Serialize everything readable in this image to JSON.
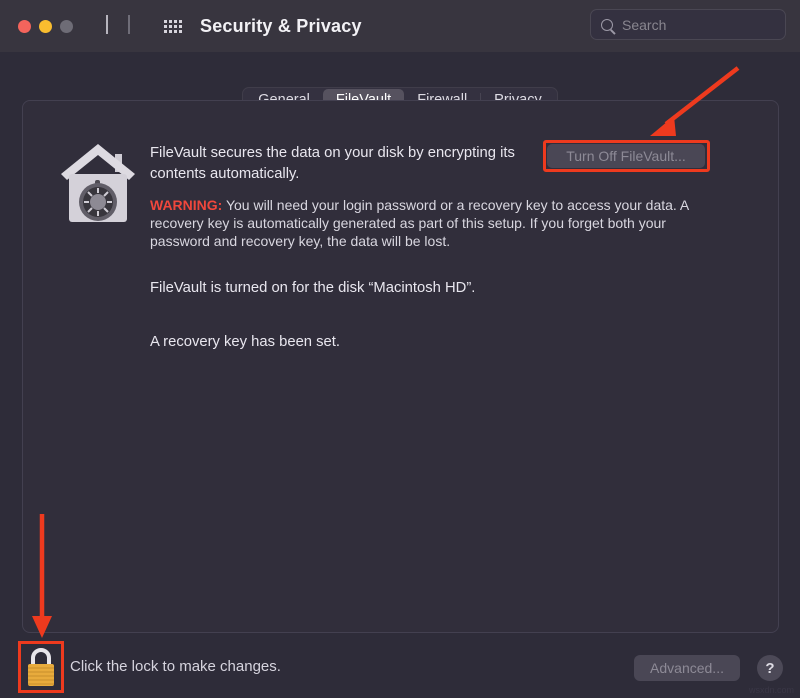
{
  "window": {
    "title": "Security & Privacy",
    "traffic_lights": [
      "close",
      "minimize",
      "maximize"
    ],
    "nav": {
      "back": "back-chevron",
      "forward": "forward-chevron"
    },
    "grid_icon": "show-all-preferences-grid-icon"
  },
  "search": {
    "placeholder": "Search",
    "value": "",
    "icon": "search-icon"
  },
  "tabs": [
    {
      "label": "General",
      "active": false
    },
    {
      "label": "FileVault",
      "active": true
    },
    {
      "label": "Firewall",
      "active": false
    },
    {
      "label": "Privacy",
      "active": false
    }
  ],
  "filevault": {
    "icon": "filevault-house-safe-icon",
    "description": "FileVault secures the data on your disk by encrypting its contents automatically.",
    "warning_label": "WARNING:",
    "warning_body": " You will need your login password or a recovery key to access your data. A recovery key is automatically generated as part of this setup. If you forget both your password and recovery key, the data will be lost.",
    "status_disk": "FileVault is turned on for the disk “Macintosh HD”.",
    "status_key": "A recovery key has been set.",
    "turn_off_button": "Turn Off FileVault..."
  },
  "footer": {
    "lock_icon": "closed-padlock-icon",
    "lock_text": "Click the lock to make changes.",
    "advanced_button": "Advanced...",
    "help_button": "?",
    "watermark": "wsxdn.com"
  },
  "annotations": {
    "arrow_to_turn_off": "red-arrow-pointing-to-turn-off-filevault-button",
    "arrow_to_lock": "red-arrow-pointing-to-lock-icon",
    "highlight_color": "#ee3a1e"
  }
}
